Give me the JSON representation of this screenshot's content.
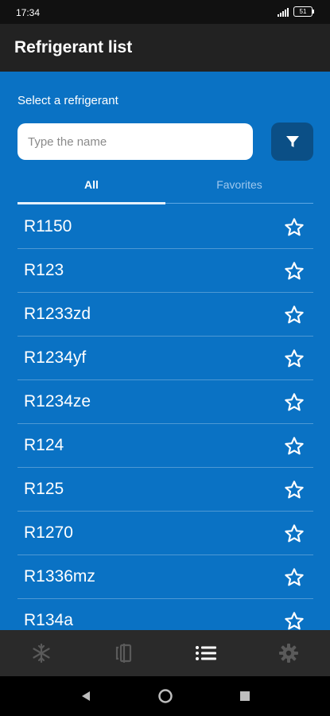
{
  "status_bar": {
    "time": "17:34",
    "battery": "51"
  },
  "app_bar": {
    "title": "Refrigerant list"
  },
  "search": {
    "prompt": "Select a refrigerant",
    "placeholder": "Type the name",
    "value": ""
  },
  "tabs": [
    {
      "label": "All",
      "selected": true
    },
    {
      "label": "Favorites",
      "selected": false
    }
  ],
  "refrigerants": [
    {
      "name": "R1150",
      "favorite": false
    },
    {
      "name": "R123",
      "favorite": false
    },
    {
      "name": "R1233zd",
      "favorite": false
    },
    {
      "name": "R1234yf",
      "favorite": false
    },
    {
      "name": "R1234ze",
      "favorite": false
    },
    {
      "name": "R124",
      "favorite": false
    },
    {
      "name": "R125",
      "favorite": false
    },
    {
      "name": "R1270",
      "favorite": false
    },
    {
      "name": "R1336mz",
      "favorite": false
    },
    {
      "name": "R134a",
      "favorite": false
    }
  ],
  "bottom_nav": [
    {
      "icon": "snowflake-icon",
      "active": false
    },
    {
      "icon": "compare-icon",
      "active": false
    },
    {
      "icon": "list-icon",
      "active": true
    },
    {
      "icon": "gear-icon",
      "active": false
    }
  ],
  "colors": {
    "accent": "#0a72c4",
    "app_bar": "#222222",
    "filter_button": "#0b4f86"
  }
}
